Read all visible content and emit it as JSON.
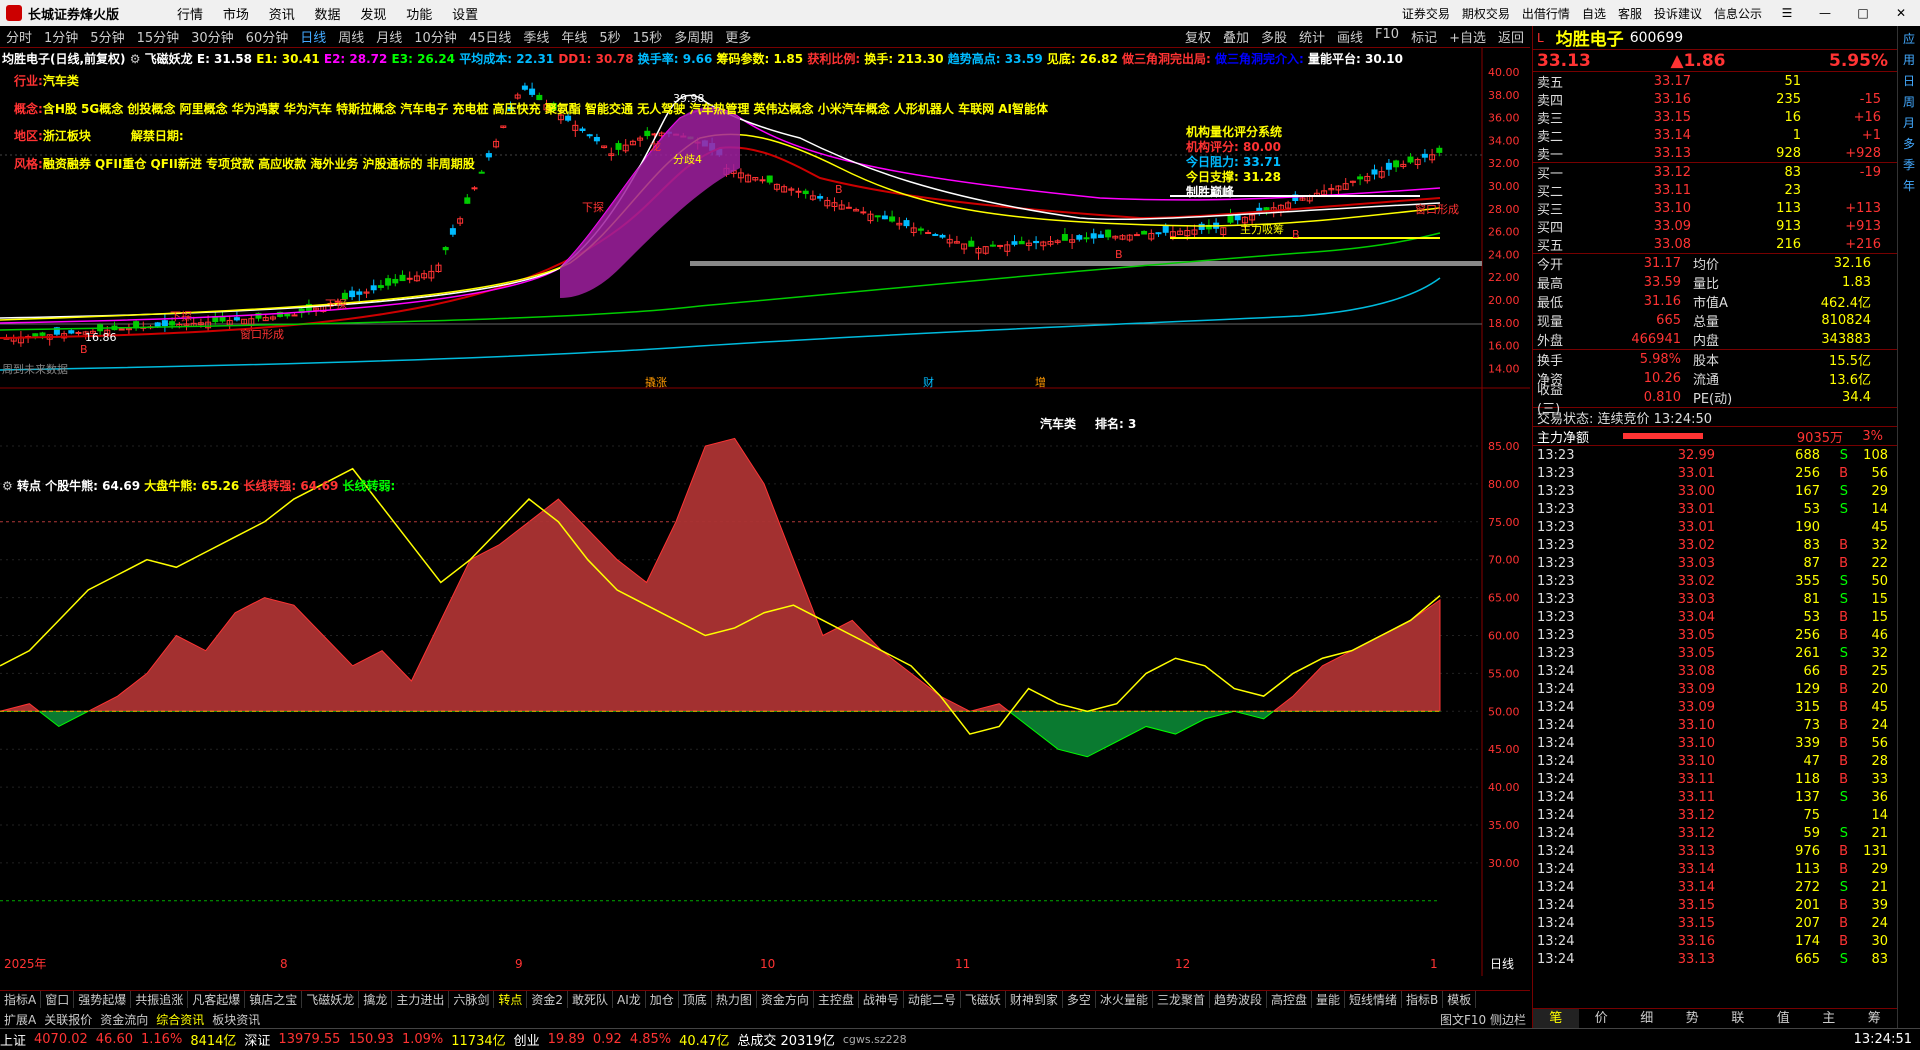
{
  "app": {
    "name": "长城证券烽火版",
    "menu": [
      "行情",
      "市场",
      "资讯",
      "数据",
      "发现",
      "功能",
      "设置"
    ],
    "right_menu": [
      "证券交易",
      "期权交易",
      "出借行情",
      "自选",
      "客服",
      "投诉建议",
      "信息公示"
    ]
  },
  "periods": [
    "分时",
    "1分钟",
    "5分钟",
    "15分钟",
    "30分钟",
    "60分钟",
    "日线",
    "周线",
    "月线",
    "10分钟",
    "45日线",
    "季线",
    "年线",
    "5秒",
    "15秒",
    "多周期",
    "更多"
  ],
  "active_period": "日线",
  "tools": [
    "复权",
    "叠加",
    "多股",
    "统计",
    "画线",
    "F10",
    "标记",
    "+自选",
    "返回"
  ],
  "main_header": {
    "name": "均胜电子(日线,前复权)",
    "indicator": "飞磁妖龙",
    "E": "E: 31.58",
    "E1": "E1: 30.41",
    "E2": "E2: 28.72",
    "E3": "E3: 26.24",
    "avgcost": "平均成本: 22.31",
    "DD1": "DD1: 30.78",
    "turnover_rate": "换手率: 9.66",
    "chip": "筹码参数: 1.85",
    "profit": "获利比例:",
    "hand": "换手: 213.30",
    "trendhigh": "趋势高点: 33.59",
    "low": "见底: 26.82",
    "tri1": "做三角洞完出局:",
    "tri2": "做三角洞完介入:",
    "volplat": "量能平台: 30.10"
  },
  "info_lines": {
    "industry_label": "行业:",
    "industry": "汽车类",
    "concept_label": "概念:",
    "concept": "含H股 5G概念 创投概念 阿里概念 华为鸿蒙 华为汽车 特斯拉概念 汽车电子 充电桩 高压快充 聚氨酯 智能交通 无人驾驶 汽车热管理 英伟达概念 小米汽车概念 人形机器人 车联网 AI智能体",
    "region_label": "地区:",
    "region": "浙江板块",
    "unlock_label": "解禁日期:",
    "style_label": "风格:",
    "style": "融资融券 QFII重仓 QFII新进 专项贷款 高应收款 海外业务 沪股通标的 非周期股"
  },
  "rating": {
    "title": "机构量化评分系统",
    "score": "机构评分: 80.00",
    "resist": "今日阻力: 33.71",
    "support": "今日支撑: 31.28",
    "signal": "制胜巅峰"
  },
  "price_axis": [
    "40.00",
    "38.00",
    "36.00",
    "34.00",
    "32.00",
    "30.00",
    "28.00",
    "26.00",
    "24.00",
    "22.00",
    "20.00",
    "18.00",
    "16.00",
    "14.00"
  ],
  "chart_labels": {
    "peak": "39.98",
    "low": "16.86",
    "fenqi": "分歧4",
    "long": "龙",
    "strong": "主力吸筹",
    "window1": "窗口形成",
    "window2": "窗口形成",
    "marker_wh": "下探",
    "marker_B": "B",
    "future": "周到未来数据",
    "ev1": "撬涨",
    "ev2": "财",
    "ev3": "增"
  },
  "sub_header": {
    "name": "转点",
    "stock_bull": "个股牛熊: 64.69",
    "market_bull": "大盘牛熊: 65.26",
    "long_strong": "长线转强: 64.69",
    "long_weak": "长线转弱:",
    "sector": "汽车类",
    "rank": "排名: 3"
  },
  "sub_axis": [
    "85.00",
    "80.00",
    "75.00",
    "70.00",
    "65.00",
    "60.00",
    "55.00",
    "50.00",
    "45.00",
    "40.00",
    "35.00",
    "30.00"
  ],
  "x_axis": [
    "2025年",
    "8",
    "9",
    "10",
    "11",
    "12",
    "1"
  ],
  "chart_data": {
    "type": "line",
    "series": [
      {
        "name": "个股牛熊",
        "values": [
          50,
          51,
          48,
          50,
          52,
          55,
          60,
          58,
          63,
          65,
          64,
          60,
          56,
          58,
          54,
          62,
          70,
          72,
          75,
          78,
          74,
          70,
          67,
          75,
          85,
          86,
          80,
          70,
          60,
          62,
          58,
          55,
          52,
          50,
          51,
          48,
          45,
          44,
          46,
          48,
          47,
          49,
          50,
          49,
          52,
          56,
          58,
          60,
          62,
          64.69
        ]
      },
      {
        "name": "大盘牛熊",
        "values": [
          56,
          58,
          62,
          66,
          68,
          70,
          69,
          71,
          73,
          75,
          78,
          80,
          82,
          77,
          72,
          67,
          70,
          74,
          78,
          75,
          70,
          66,
          64,
          62,
          60,
          61,
          63,
          64,
          62,
          60,
          58,
          56,
          52,
          47,
          48,
          53,
          51,
          50,
          51,
          55,
          57,
          56,
          53,
          52,
          55,
          57,
          58,
          60,
          62,
          65.26
        ]
      }
    ],
    "ylim": [
      25,
      90
    ]
  },
  "bottom_tabs": [
    "指标A",
    "窗口",
    "强势起爆",
    "共振追涨",
    "凡客起爆",
    "镇店之宝",
    "飞磁妖龙",
    "擒龙",
    "主力进出",
    "六脉剑",
    "转点",
    "资金2",
    "敢死队",
    "AI龙",
    "加仓",
    "顶底",
    "热力图",
    "资金方向",
    "主控盘",
    "战神号",
    "动能二号",
    "飞磁妖",
    "财神到家",
    "多空",
    "冰火量能",
    "三龙聚首",
    "趋势波段",
    "高控盘",
    "量能",
    "短线情绪",
    "指标B",
    "模板"
  ],
  "active_tab": "转点",
  "bottom_tabs2": [
    "扩展A",
    "关联报价",
    "资金流向",
    "综合资讯",
    "板块资讯"
  ],
  "right_links": "图文F10 侧边栏",
  "stock": {
    "name": "均胜电子",
    "code": "600699",
    "price": "33.13",
    "change": "▲1.86",
    "pct": "5.95%"
  },
  "asks": [
    {
      "l": "卖五",
      "p": "33.17",
      "v": "51",
      "c": ""
    },
    {
      "l": "卖四",
      "p": "33.16",
      "v": "235",
      "c": "-15"
    },
    {
      "l": "卖三",
      "p": "33.15",
      "v": "16",
      "c": "+16"
    },
    {
      "l": "卖二",
      "p": "33.14",
      "v": "1",
      "c": "+1"
    },
    {
      "l": "卖一",
      "p": "33.13",
      "v": "928",
      "c": "+928"
    }
  ],
  "bids": [
    {
      "l": "买一",
      "p": "33.12",
      "v": "83",
      "c": "-19"
    },
    {
      "l": "买二",
      "p": "33.11",
      "v": "23",
      "c": ""
    },
    {
      "l": "买三",
      "p": "33.10",
      "v": "113",
      "c": "+113"
    },
    {
      "l": "买四",
      "p": "33.09",
      "v": "913",
      "c": "+913"
    },
    {
      "l": "买五",
      "p": "33.08",
      "v": "216",
      "c": "+216"
    }
  ],
  "quote": [
    {
      "k": "今开",
      "v": "31.17",
      "k2": "均价",
      "v2": "32.16"
    },
    {
      "k": "最高",
      "v": "33.59",
      "k2": "量比",
      "v2": "1.83"
    },
    {
      "k": "最低",
      "v": "31.16",
      "k2": "市值A",
      "v2": "462.4亿"
    },
    {
      "k": "现量",
      "v": "665",
      "k2": "总量",
      "v2": "810824"
    },
    {
      "k": "外盘",
      "v": "466941",
      "k2": "内盘",
      "v2": "343883"
    }
  ],
  "fund": [
    {
      "k": "换手",
      "v": "5.98%",
      "k2": "股本",
      "v2": "15.5亿"
    },
    {
      "k": "净资",
      "v": "10.26",
      "k2": "流通",
      "v2": "13.6亿"
    },
    {
      "k": "收益(三)",
      "v": "0.810",
      "k2": "PE(动)",
      "v2": "34.4"
    }
  ],
  "trade_state": "交易状态: 连续竞价 13:24:50",
  "main_flow": {
    "label": "主力净额",
    "value": "9035万",
    "pct": "3%"
  },
  "ticks": [
    [
      "13:23",
      "32.99",
      "688",
      "S",
      "108"
    ],
    [
      "13:23",
      "33.01",
      "256",
      "B",
      "56"
    ],
    [
      "13:23",
      "33.00",
      "167",
      "S",
      "29"
    ],
    [
      "13:23",
      "33.01",
      "53",
      "S",
      "14"
    ],
    [
      "13:23",
      "33.01",
      "190",
      "",
      "45"
    ],
    [
      "13:23",
      "33.02",
      "83",
      "B",
      "32"
    ],
    [
      "13:23",
      "33.03",
      "87",
      "B",
      "22"
    ],
    [
      "13:23",
      "33.02",
      "355",
      "S",
      "50"
    ],
    [
      "13:23",
      "33.03",
      "81",
      "S",
      "15"
    ],
    [
      "13:23",
      "33.04",
      "53",
      "B",
      "15"
    ],
    [
      "13:23",
      "33.05",
      "256",
      "B",
      "46"
    ],
    [
      "13:23",
      "33.05",
      "261",
      "S",
      "32"
    ],
    [
      "13:24",
      "33.08",
      "66",
      "B",
      "25"
    ],
    [
      "13:24",
      "33.09",
      "129",
      "B",
      "20"
    ],
    [
      "13:24",
      "33.09",
      "315",
      "B",
      "45"
    ],
    [
      "13:24",
      "33.10",
      "73",
      "B",
      "24"
    ],
    [
      "13:24",
      "33.10",
      "339",
      "B",
      "56"
    ],
    [
      "13:24",
      "33.10",
      "47",
      "B",
      "28"
    ],
    [
      "13:24",
      "33.11",
      "118",
      "B",
      "33"
    ],
    [
      "13:24",
      "33.11",
      "137",
      "S",
      "36"
    ],
    [
      "13:24",
      "33.12",
      "75",
      "",
      "14"
    ],
    [
      "13:24",
      "33.12",
      "59",
      "S",
      "21"
    ],
    [
      "13:24",
      "33.13",
      "976",
      "B",
      "131"
    ],
    [
      "13:24",
      "33.14",
      "113",
      "B",
      "29"
    ],
    [
      "13:24",
      "33.14",
      "272",
      "S",
      "21"
    ],
    [
      "13:24",
      "33.15",
      "201",
      "B",
      "39"
    ],
    [
      "13:24",
      "33.15",
      "207",
      "B",
      "24"
    ],
    [
      "13:24",
      "33.16",
      "174",
      "B",
      "30"
    ],
    [
      "13:24",
      "33.13",
      "665",
      "S",
      "83"
    ]
  ],
  "right_tabs": [
    "笔",
    "价",
    "细",
    "势",
    "联",
    "值",
    "主",
    "筹"
  ],
  "sidebar_items": [
    "应",
    "用",
    "日",
    "周",
    "月",
    "多",
    "季",
    "年"
  ],
  "status": {
    "sh_label": "上证",
    "sh": "4070.02",
    "sh_chg": "46.60",
    "sh_pct": "1.16%",
    "sh_amt": "8414亿",
    "sz_label": "深证",
    "sz": "13979.55",
    "sz_chg": "150.93",
    "sz_pct": "1.09%",
    "sz_amt": "11734亿",
    "cy_label": "创业",
    "cy": "19.89",
    "cy_chg": "0.92",
    "cy_pct": "4.85%",
    "cy_amt": "40.47亿",
    "total": "总成交 20319亿",
    "server": "cgws.sz228",
    "time": "13:24:51"
  }
}
